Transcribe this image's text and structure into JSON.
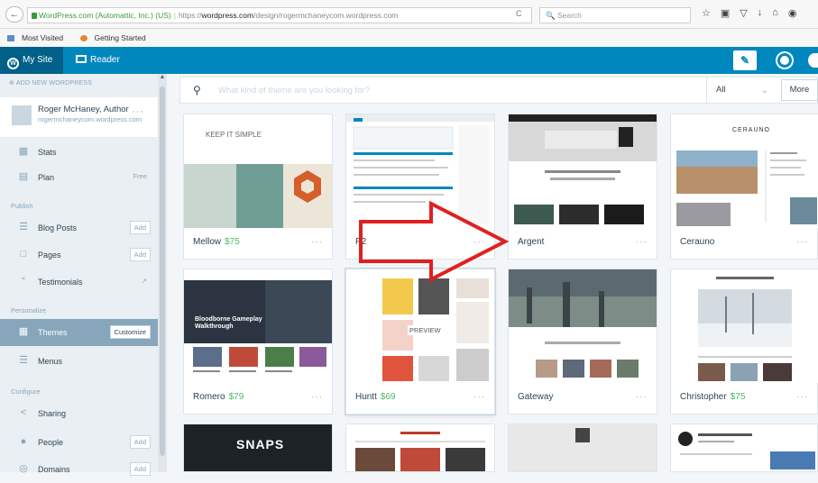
{
  "browser": {
    "secure_label": "WordPress.com (Automattic, Inc.) (US)",
    "url_prefix": "https://",
    "url_host": "wordpress.com",
    "url_path": "/design/rogermchaneycom.wordpress.com",
    "search_placeholder": "Search",
    "bookmarks": [
      "Most Visited",
      "Getting Started"
    ]
  },
  "masterbar": {
    "my_site": "My Site",
    "reader": "Reader"
  },
  "sidebar": {
    "add_new": "ADD NEW WORDPRESS",
    "site_title": "Roger McHaney, Author",
    "site_url": "rogermchaneycom.wordpress.com",
    "items": [
      {
        "label": "Stats",
        "icon": "stats-icon"
      },
      {
        "label": "Plan",
        "extra": "Free",
        "icon": "plan-icon"
      },
      {
        "label": "Blog Posts",
        "extra": "Add",
        "icon": "posts-icon"
      },
      {
        "label": "Pages",
        "extra": "Add",
        "icon": "pages-icon"
      },
      {
        "label": "Testimonials",
        "icon": "testimonials-icon"
      },
      {
        "label": "Themes",
        "extra": "Customize",
        "icon": "themes-icon"
      },
      {
        "label": "Menus",
        "icon": "menus-icon"
      },
      {
        "label": "Sharing",
        "icon": "sharing-icon"
      },
      {
        "label": "People",
        "extra": "Add",
        "icon": "people-icon"
      },
      {
        "label": "Domains",
        "extra": "Add",
        "icon": "domains-icon"
      }
    ],
    "headings": [
      "Publish",
      "Personalize",
      "Configure"
    ]
  },
  "search": {
    "placeholder": "What kind of theme are you looking for?",
    "filter": "All",
    "more": "More"
  },
  "themes": [
    {
      "name": "Mellow",
      "price": "$75"
    },
    {
      "name": "P2",
      "price": ""
    },
    {
      "name": "Argent",
      "price": ""
    },
    {
      "name": "Cerauno",
      "price": ""
    },
    {
      "name": "Romero",
      "price": "$79"
    },
    {
      "name": "Huntt",
      "price": "$69"
    },
    {
      "name": "Gateway",
      "price": ""
    },
    {
      "name": "Christopher",
      "price": "$75"
    }
  ],
  "previews": {
    "mellow_tagline": "KEEP IT SIMPLE",
    "romero_headline": "Bloodborne Gameplay Walkthrough",
    "huntt_preview": "PREVIEW",
    "snaps": "SNAPS",
    "cerauno": "CERAUNO"
  }
}
